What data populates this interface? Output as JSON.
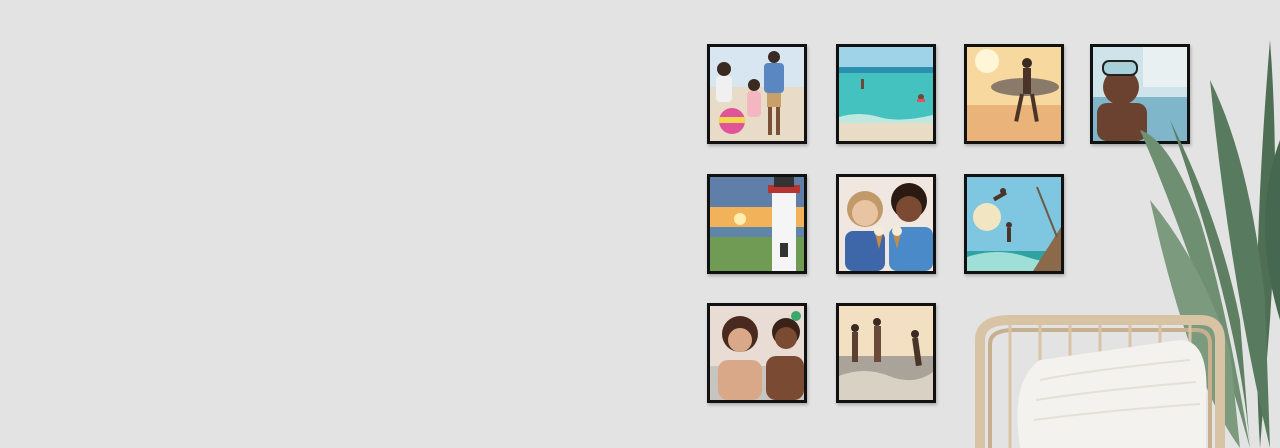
{
  "scene": {
    "background_color": "#e3e3e3",
    "frame_color": "#111111"
  },
  "gallery": {
    "tiles": [
      {
        "name": "family-beach-ball-photo",
        "sky": "#d7e6f0",
        "ground": "#e8dcc8"
      },
      {
        "name": "ocean-swimmers-photo",
        "sky": "#9fd3e8",
        "ground": "#44c2c0"
      },
      {
        "name": "surfer-sunset-photo",
        "sky": "#f7d9a0",
        "ground": "#e9b37a"
      },
      {
        "name": "snorkel-kid-photo",
        "sky": "#cfe3ea",
        "ground": "#7fb6c9"
      },
      {
        "name": "lighthouse-sunset-photo",
        "sky": "#f2b25a",
        "ground": "#6f9b55"
      },
      {
        "name": "kids-ice-cream-photo",
        "sky": "#f0e8e0",
        "ground": "#3d67a8"
      },
      {
        "name": "cliff-jumpers-photo",
        "sky": "#7fc6e0",
        "ground": "#2fa3a2"
      },
      {
        "name": "friends-laughing-photo",
        "sky": "#e8dcd4",
        "ground": "#b98a6e"
      },
      {
        "name": "beach-splash-photo",
        "sky": "#f3e0c2",
        "ground": "#a9a39a"
      }
    ]
  },
  "decor": {
    "plant_color": "#5f7f63",
    "chair_color": "#d8c3a5",
    "pillow_color": "#f4f2ee"
  }
}
